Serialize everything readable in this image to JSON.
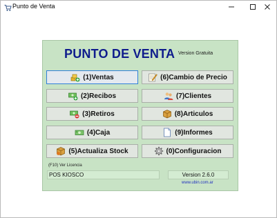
{
  "window": {
    "title": "Punto de Venta",
    "controls": {
      "minimize": "—",
      "maximize": "□",
      "close": "✕"
    }
  },
  "header": {
    "app_title": "PUNTO DE VENTA",
    "version_label": "Version Gratuita"
  },
  "buttons": {
    "ventas": "(1)Ventas",
    "cambio_precio": "(6)Cambio de Precio",
    "recibos": "(2)Recibos",
    "clientes": "(7)Clientes",
    "retiros": "(3)Retiros",
    "articulos": "(8)Articulos",
    "caja": "(4)Caja",
    "informes": "(9)Informes",
    "actualiza_stock": "(5)Actualiza Stock",
    "configuracion": "(0)Configuracion"
  },
  "footer": {
    "license_hint": "(F10) Ver Licencia",
    "pos_name": "POS KIOSCO",
    "version": "Version 2.6.0",
    "website": "www.ubin.com.ar"
  },
  "colors": {
    "panel_bg": "#c8e3c5",
    "title_color": "#0f1c8c",
    "button_bg": "#e1e6e0",
    "focus_border": "#2f7fd8",
    "link_color": "#1f2fbf"
  },
  "icons": {
    "ventas": "coins-plus-icon",
    "cambio_precio": "notepad-pencil-icon",
    "recibos": "money-plus-icon",
    "clientes": "users-icon",
    "retiros": "money-minus-icon",
    "articulos": "box-icon",
    "caja": "cash-icon",
    "informes": "document-icon",
    "actualiza_stock": "box-update-icon",
    "configuracion": "gear-icon"
  }
}
